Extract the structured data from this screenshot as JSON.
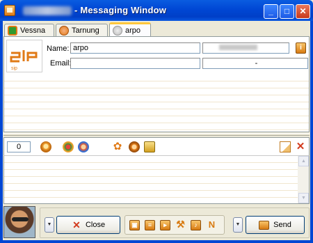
{
  "window": {
    "title": "- Messaging Window",
    "minimize": "_",
    "maximize": "□",
    "close": "✕"
  },
  "tabs": [
    {
      "label": "Vessna",
      "icon": "contact-online-icon"
    },
    {
      "label": "Tarnung",
      "icon": "contact-status-icon"
    },
    {
      "label": "arpo",
      "icon": "contact-offline-icon"
    }
  ],
  "contact": {
    "logo_text": "sip",
    "name_label": "Name:",
    "name_value": "arpo",
    "email_label": "Email:",
    "email_value": "",
    "secondary_value": "-"
  },
  "toolbar": {
    "message_count": "0"
  },
  "buttons": {
    "close_label": "Close",
    "send_label": "Send"
  },
  "colors": {
    "title_bar": "#0047d4",
    "accent_orange": "#e07a16",
    "close_red": "#d23b1e"
  }
}
